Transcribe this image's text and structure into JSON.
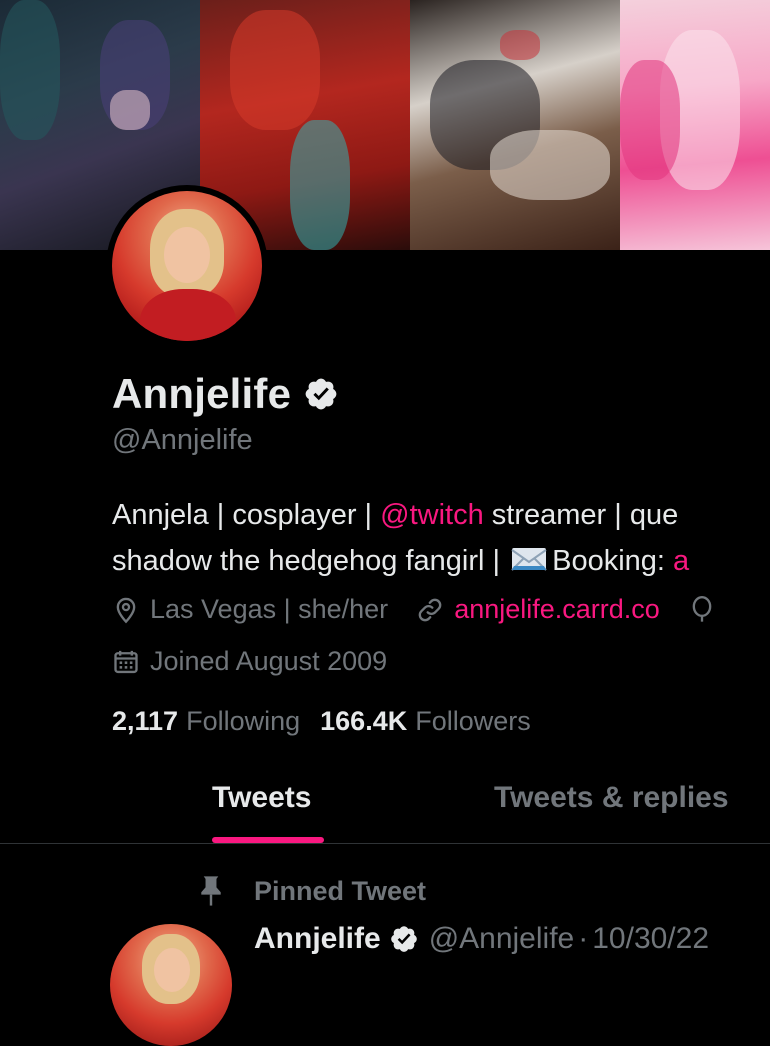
{
  "profile": {
    "display_name": "Annjelife",
    "handle": "@Annjelife",
    "bio_line1_start": "Annjela | cosplayer | ",
    "bio_mention": "@twitch",
    "bio_line1_end": " streamer | que",
    "bio_line2_start": "shadow the hedgehog fangirl | ",
    "bio_booking": "Booking: ",
    "bio_booking_link": "a",
    "location": "Las Vegas | she/her",
    "website": "annjelife.carrd.co",
    "joined": "Joined August 2009",
    "following_count": "2,117",
    "following_label": "Following",
    "followers_count": "166.4K",
    "followers_label": "Followers"
  },
  "tabs": [
    {
      "label": "Tweets",
      "active": true
    },
    {
      "label": "Tweets & replies",
      "active": false
    }
  ],
  "pinned_tweet": {
    "pinned_label": "Pinned Tweet",
    "author": "Annjelife",
    "handle": "@Annjelife",
    "separator": "·",
    "date": "10/30/22"
  },
  "colors": {
    "accent": "#f91880",
    "background": "#000000",
    "primary_text": "#e7e9ea",
    "secondary_text": "#71767b"
  },
  "icons": [
    "verified-badge-icon",
    "location-pin-icon",
    "link-icon",
    "birthday-balloon-icon",
    "calendar-icon",
    "envelope-emoji-icon",
    "pin-icon"
  ]
}
